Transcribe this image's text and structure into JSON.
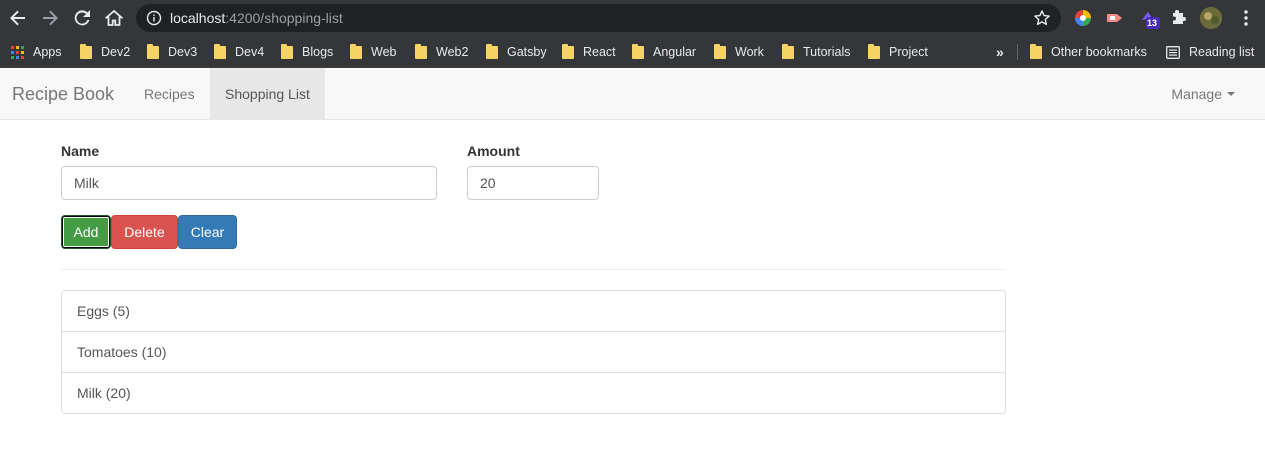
{
  "browser": {
    "url_host": "localhost",
    "url_path": ":4200/shopping-list",
    "extension_badge": "13",
    "bookmarks": [
      {
        "label": "Apps",
        "type": "apps"
      },
      {
        "label": "Dev2",
        "type": "folder"
      },
      {
        "label": "Dev3",
        "type": "folder"
      },
      {
        "label": "Dev4",
        "type": "folder"
      },
      {
        "label": "Blogs",
        "type": "folder"
      },
      {
        "label": "Web",
        "type": "folder"
      },
      {
        "label": "Web2",
        "type": "folder"
      },
      {
        "label": "Gatsby",
        "type": "folder"
      },
      {
        "label": "React",
        "type": "folder"
      },
      {
        "label": "Angular",
        "type": "folder"
      },
      {
        "label": "Work",
        "type": "folder"
      },
      {
        "label": "Tutorials",
        "type": "folder"
      },
      {
        "label": "Project",
        "type": "folder"
      }
    ],
    "overflow": "»",
    "other_bookmarks": "Other bookmarks",
    "reading_list": "Reading list"
  },
  "navbar": {
    "brand": "Recipe Book",
    "links": [
      {
        "label": "Recipes",
        "active": false
      },
      {
        "label": "Shopping List",
        "active": true
      }
    ],
    "manage": "Manage"
  },
  "form": {
    "name_label": "Name",
    "name_value": "Milk",
    "amount_label": "Amount",
    "amount_value": "20",
    "add_label": "Add",
    "delete_label": "Delete",
    "clear_label": "Clear"
  },
  "shopping_list": [
    {
      "text": "Eggs (5)"
    },
    {
      "text": "Tomatoes (10)"
    },
    {
      "text": "Milk (20)"
    }
  ]
}
